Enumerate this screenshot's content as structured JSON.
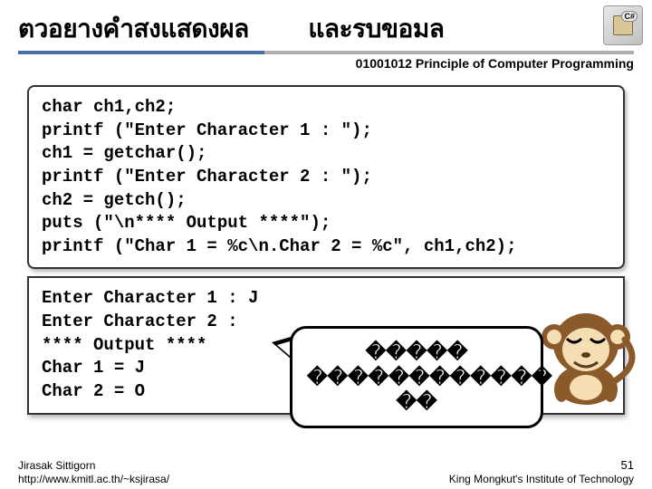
{
  "header": {
    "title_left": "ตวอยางคำสงแสดงผล",
    "title_right": "และรบขอมล",
    "subtitle": "01001012 Principle of Computer Programming"
  },
  "code": {
    "l1": "char ch1,ch2;",
    "l2": "printf (\"Enter Character 1 : \");",
    "l3": "ch1 = getchar();",
    "l4": "printf (\"Enter Character 2 : \");",
    "l5": "ch2 = getch();",
    "l6": "puts (\"\\n**** Output ****\");",
    "l7": "printf (\"Char 1 = %c\\n.Char 2 = %c\", ch1,ch2);"
  },
  "output": {
    "text": "Enter Character 1 : J\nEnter Character 2 :\n**** Output ****\nChar 1 = J\nChar 2 = O"
  },
  "bubble": {
    "line1": "�����",
    "line2": "������������",
    "line3": "��"
  },
  "footer": {
    "author": "Jirasak Sittigorn",
    "url": "http://www.kmitl.ac.th/~ksjirasa/",
    "page": "51",
    "institute": "King Mongkut's Institute of Technology"
  },
  "icons": {
    "corner": "csharp-badge",
    "mascot": "monkey-cartoon"
  }
}
